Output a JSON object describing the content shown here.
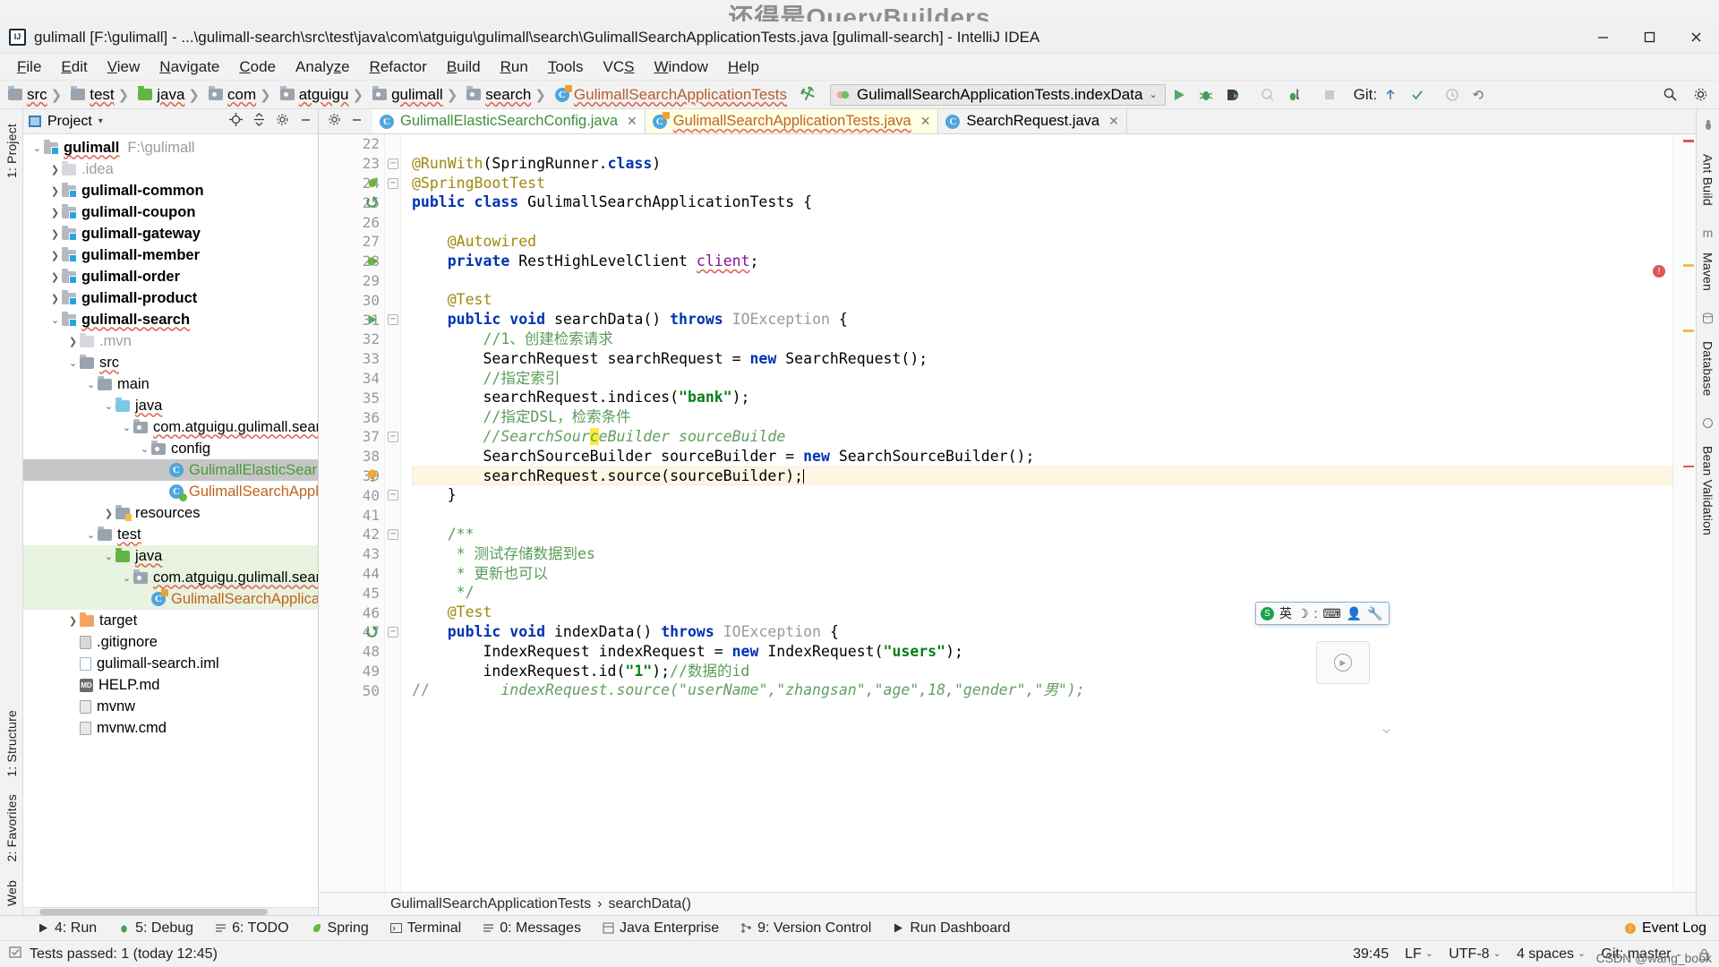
{
  "watermark": "还得是QueryBuilders",
  "window": {
    "title": "gulimall [F:\\gulimall] - ...\\gulimall-search\\src\\test\\java\\com\\atguigu\\gulimall\\search\\GulimallSearchApplicationTests.java [gulimall-search] - IntelliJ IDEA",
    "logo": "IJ",
    "minimize": "minimize-icon",
    "maximize": "maximize-icon",
    "close": "close-icon"
  },
  "menubar": [
    {
      "label": "File"
    },
    {
      "label": "Edit"
    },
    {
      "label": "View"
    },
    {
      "label": "Navigate"
    },
    {
      "label": "Code"
    },
    {
      "label": "Analyze"
    },
    {
      "label": "Refactor"
    },
    {
      "label": "Build"
    },
    {
      "label": "Run"
    },
    {
      "label": "Tools"
    },
    {
      "label": "VCS"
    },
    {
      "label": "Window"
    },
    {
      "label": "Help"
    }
  ],
  "navbar": {
    "breadcrumbs": [
      {
        "label": "src",
        "icon": "folder-icon"
      },
      {
        "label": "test",
        "icon": "folder-icon"
      },
      {
        "label": "java",
        "icon": "folder-green-icon"
      },
      {
        "label": "com",
        "icon": "package-icon"
      },
      {
        "label": "atguigu",
        "icon": "package-icon"
      },
      {
        "label": "gulimall",
        "icon": "package-icon"
      },
      {
        "label": "search",
        "icon": "package-icon"
      },
      {
        "label": "GulimallSearchApplicationTests",
        "icon": "class-test-icon"
      }
    ],
    "build_icon": "hammer-icon",
    "run_config": "GulimallSearchApplicationTests.indexData",
    "run_config_icon": "run-config-icon",
    "dropdown_icon": "chevron-down-icon",
    "buttons": [
      {
        "name": "run-button",
        "icon": "play-icon"
      },
      {
        "name": "debug-button",
        "icon": "bug-icon"
      },
      {
        "name": "run-with-coverage-button",
        "icon": "coverage-icon"
      },
      {
        "name": "profile-button",
        "icon": "profiler-icon"
      },
      {
        "name": "attach-debugger-button",
        "icon": "attach-icon"
      },
      {
        "name": "stop-button",
        "icon": "stop-icon"
      }
    ],
    "git_label": "Git:",
    "git_buttons": [
      {
        "name": "update-project-button",
        "icon": "update-arrow-icon"
      },
      {
        "name": "commit-button",
        "icon": "check-icon"
      },
      {
        "name": "history-button",
        "icon": "clock-icon"
      },
      {
        "name": "rollback-button",
        "icon": "undo-icon"
      }
    ],
    "right_buttons": [
      {
        "name": "search-everywhere-button",
        "icon": "search-icon"
      },
      {
        "name": "settings-button",
        "icon": "gear-icon"
      },
      {
        "name": "layout-button",
        "icon": "layout-icon"
      }
    ]
  },
  "left_rail": [
    {
      "label": "1: Project",
      "name": "rail-tab-project"
    },
    {
      "label": "1: Structure",
      "name": "rail-tab-structure"
    },
    {
      "label": "2: Favorites",
      "name": "rail-tab-favorites"
    },
    {
      "label": "Web",
      "name": "rail-tab-web"
    }
  ],
  "right_rail": [
    {
      "label": "Ant Build",
      "name": "rail-tab-ant-build"
    },
    {
      "label": "Maven",
      "name": "rail-tab-maven"
    },
    {
      "label": "Database",
      "name": "rail-tab-database"
    },
    {
      "label": "Bean Validation",
      "name": "rail-tab-bean-validation"
    }
  ],
  "project_panel": {
    "title": "Project",
    "dropdown_icon": "chevron-down-icon",
    "actions": [
      {
        "name": "locate-file-button",
        "icon": "crosshair-icon"
      },
      {
        "name": "collapse-all-button",
        "icon": "collapse-icon"
      },
      {
        "name": "settings-button",
        "icon": "gear-icon"
      },
      {
        "name": "hide-button",
        "icon": "minimize-icon"
      }
    ],
    "tree": [
      {
        "depth": 0,
        "arrow": "down",
        "icon": "module-folder-icon",
        "label": "gulimall",
        "bold": true,
        "suffix": "F:\\gulimall",
        "spell": true
      },
      {
        "depth": 1,
        "arrow": "right",
        "icon": "folder-gray-icon",
        "label": ".idea",
        "gray": true
      },
      {
        "depth": 1,
        "arrow": "right",
        "icon": "module-folder-icon",
        "label": "gulimall-common",
        "bold": true
      },
      {
        "depth": 1,
        "arrow": "right",
        "icon": "module-folder-icon",
        "label": "gulimall-coupon",
        "bold": true
      },
      {
        "depth": 1,
        "arrow": "right",
        "icon": "module-folder-icon",
        "label": "gulimall-gateway",
        "bold": true
      },
      {
        "depth": 1,
        "arrow": "right",
        "icon": "module-folder-icon",
        "label": "gulimall-member",
        "bold": true
      },
      {
        "depth": 1,
        "arrow": "right",
        "icon": "module-folder-icon",
        "label": "gulimall-order",
        "bold": true
      },
      {
        "depth": 1,
        "arrow": "right",
        "icon": "module-folder-icon",
        "label": "gulimall-product",
        "bold": true
      },
      {
        "depth": 1,
        "arrow": "down",
        "icon": "module-folder-icon",
        "label": "gulimall-search",
        "bold": true,
        "spell": true
      },
      {
        "depth": 2,
        "arrow": "right",
        "icon": "folder-gray-icon",
        "label": ".mvn",
        "gray": true
      },
      {
        "depth": 2,
        "arrow": "down",
        "icon": "folder-icon",
        "label": "src",
        "spell": true
      },
      {
        "depth": 3,
        "arrow": "down",
        "icon": "folder-icon",
        "label": "main"
      },
      {
        "depth": 4,
        "arrow": "down",
        "icon": "folder-blue-icon",
        "label": "java",
        "spell": true
      },
      {
        "depth": 5,
        "arrow": "down",
        "icon": "package-icon",
        "label": "com.atguigu.gulimall.sear",
        "spell": true
      },
      {
        "depth": 6,
        "arrow": "down",
        "icon": "package-icon",
        "label": "config"
      },
      {
        "depth": 7,
        "arrow": "none",
        "icon": "class-icon",
        "label": "GulimallElasticSear",
        "color": "green",
        "selected": true
      },
      {
        "depth": 7,
        "arrow": "none",
        "icon": "class-run-icon",
        "label": "GulimallSearchApplica",
        "color": "orange"
      },
      {
        "depth": 4,
        "arrow": "right",
        "icon": "resources-folder-icon",
        "label": "resources"
      },
      {
        "depth": 3,
        "arrow": "down",
        "icon": "folder-icon",
        "label": "test",
        "spell": true
      },
      {
        "depth": 4,
        "arrow": "down",
        "icon": "folder-green-icon",
        "label": "java",
        "green_bg": true,
        "spell": true
      },
      {
        "depth": 5,
        "arrow": "down",
        "icon": "package-icon",
        "label": "com.atguigu.gulimall.sear",
        "green_bg": true,
        "spell": true
      },
      {
        "depth": 6,
        "arrow": "none",
        "icon": "class-test-icon",
        "label": "GulimallSearchApplica",
        "color": "orange",
        "green_bg": true
      },
      {
        "depth": 2,
        "arrow": "right",
        "icon": "folder-orange-icon",
        "label": "target"
      },
      {
        "depth": 2,
        "arrow": "none",
        "icon": "file-git-icon",
        "label": ".gitignore"
      },
      {
        "depth": 2,
        "arrow": "none",
        "icon": "file-iml-icon",
        "label": "gulimall-search.iml"
      },
      {
        "depth": 2,
        "arrow": "none",
        "icon": "markdown-icon",
        "label": "HELP.md"
      },
      {
        "depth": 2,
        "arrow": "none",
        "icon": "file-icon",
        "label": "mvnw"
      },
      {
        "depth": 2,
        "arrow": "none",
        "icon": "file-icon",
        "label": "mvnw.cmd"
      }
    ]
  },
  "editor": {
    "tabs": [
      {
        "label": "GulimallElasticSearchConfig.java",
        "icon": "class-icon",
        "color": "green",
        "active": true,
        "closable": true
      },
      {
        "label": "GulimallSearchApplicationTests.java",
        "icon": "class-test-icon",
        "color": "orange",
        "current": true,
        "closable": true,
        "spell": true
      },
      {
        "label": "SearchRequest.java",
        "icon": "class-icon",
        "color": "plain",
        "closable": true
      }
    ],
    "first_line_number": 22,
    "lines": [
      {
        "n": 22,
        "text": ""
      },
      {
        "n": 23,
        "text": "@RunWith(SpringRunner.class)",
        "fold": true
      },
      {
        "n": 24,
        "text": "@SpringBootTest",
        "gmark": "spring-leaf-icon",
        "fold": true
      },
      {
        "n": 25,
        "text": "public class GulimallSearchApplicationTests {",
        "gmark": "implemented-icon"
      },
      {
        "n": 26,
        "text": ""
      },
      {
        "n": 27,
        "text": "    @Autowired"
      },
      {
        "n": 28,
        "text": "    private RestHighLevelClient client;",
        "gmark": "bean-icon"
      },
      {
        "n": 29,
        "text": ""
      },
      {
        "n": 30,
        "text": "    @Test"
      },
      {
        "n": 31,
        "text": "    public void searchData() throws IOException {",
        "gmark": "run-test-icon",
        "fold": true
      },
      {
        "n": 32,
        "text": "        //1、创建检索请求"
      },
      {
        "n": 33,
        "text": "        SearchRequest searchRequest = new SearchRequest();"
      },
      {
        "n": 34,
        "text": "        //指定索引"
      },
      {
        "n": 35,
        "text": "        searchRequest.indices(\"bank\");"
      },
      {
        "n": 36,
        "text": "        //指定DSL，检索条件"
      },
      {
        "n": 37,
        "text": "        //SearchSourceBuilder sourceBuilde",
        "fold": true
      },
      {
        "n": 38,
        "text": "        SearchSourceBuilder sourceBuilder = new SearchSourceBuilder();"
      },
      {
        "n": 39,
        "text": "        searchRequest.source(sourceBuilder);",
        "gmark": "intention-bulb-icon",
        "highlight": true
      },
      {
        "n": 40,
        "text": "    }",
        "fold": true
      },
      {
        "n": 41,
        "text": ""
      },
      {
        "n": 42,
        "text": "    /**",
        "fold": true
      },
      {
        "n": 43,
        "text": "     * 测试存储数据到es"
      },
      {
        "n": 44,
        "text": "     * 更新也可以"
      },
      {
        "n": 45,
        "text": "     */"
      },
      {
        "n": 46,
        "text": "    @Test"
      },
      {
        "n": 47,
        "text": "    public void indexData() throws IOException {",
        "gmark": "implemented-icon",
        "fold": true
      },
      {
        "n": 48,
        "text": "        IndexRequest indexRequest = new IndexRequest(\"users\");"
      },
      {
        "n": 49,
        "text": "        indexRequest.id(\"1\");//数据的id"
      },
      {
        "n": 50,
        "text": "//        indexRequest.source(\"userName\",\"zhangsan\",\"age\",18,\"gender\",\"男\");"
      }
    ],
    "breadcrumb": [
      "GulimallSearchApplicationTests",
      "searchData()"
    ],
    "breadcrumb_sep": "›"
  },
  "bottom_toolwindows": [
    {
      "label": "4: Run",
      "icon": "play-icon",
      "name": "tool-window-run"
    },
    {
      "label": "5: Debug",
      "icon": "bug-icon",
      "name": "tool-window-debug"
    },
    {
      "label": "6: TODO",
      "icon": "todo-icon",
      "name": "tool-window-todo"
    },
    {
      "label": "Spring",
      "icon": "spring-leaf-icon",
      "name": "tool-window-spring"
    },
    {
      "label": "Terminal",
      "icon": "terminal-icon",
      "name": "tool-window-terminal"
    },
    {
      "label": "0: Messages",
      "icon": "messages-icon",
      "name": "tool-window-messages"
    },
    {
      "label": "Java Enterprise",
      "icon": "java-ee-icon",
      "name": "tool-window-java-enterprise"
    },
    {
      "label": "9: Version Control",
      "icon": "branch-icon",
      "name": "tool-window-version-control"
    },
    {
      "label": "Run Dashboard",
      "icon": "play-icon",
      "name": "tool-window-run-dashboard"
    }
  ],
  "event_log": {
    "label": "Event Log",
    "icon": "event-log-icon"
  },
  "statusbar": {
    "icon": "tests-icon",
    "message": "Tests passed: 1 (today 12:45)",
    "caret_position": "39:45",
    "line_separator": "LF",
    "encoding": "UTF-8",
    "indent": "4 spaces",
    "branch": "Git: master",
    "lock_icon": "lock-icon",
    "chevron": "⌄"
  },
  "ime_bar": {
    "logo": "sogou-icon",
    "lang": "英",
    "items": [
      "moon-icon",
      "colon-icon",
      "keyboard-icon",
      "user-icon",
      "tools-icon"
    ]
  },
  "credit": "CSDN @wang_book"
}
